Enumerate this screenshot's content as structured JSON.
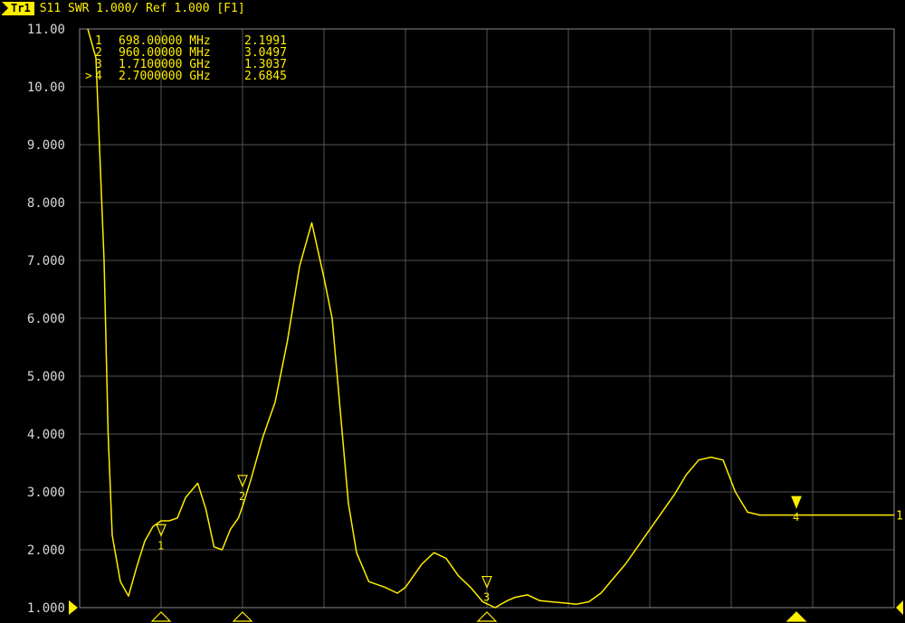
{
  "header": {
    "trace_label": "Tr1",
    "trace_info": "S11 SWR 1.000/ Ref 1.000 [F1]"
  },
  "colors": {
    "trace": "#ffee00",
    "grid": "#555555",
    "background": "#000000",
    "axis_text": "#d8d8d8"
  },
  "chart_data": {
    "type": "line",
    "title": "",
    "xlabel": "",
    "ylabel": "",
    "grid": true,
    "xlim": [
      0,
      10
    ],
    "ylim": [
      1,
      11
    ],
    "yticks": [
      "11.00",
      "10.00",
      "9.000",
      "8.000",
      "7.000",
      "6.000",
      "5.000",
      "4.000",
      "3.000",
      "2.000",
      "1.000"
    ],
    "series": [
      {
        "x": [
          0.1,
          0.2,
          0.3,
          0.35,
          0.4,
          0.5,
          0.6,
          0.7,
          0.8,
          0.9,
          1.0,
          1.1,
          1.2,
          1.3,
          1.45,
          1.55,
          1.65,
          1.75,
          1.85,
          1.95,
          2.0,
          2.1,
          2.25,
          2.4,
          2.55,
          2.7,
          2.85,
          3.0,
          3.1,
          3.2,
          3.3,
          3.4,
          3.55,
          3.75,
          3.9,
          4.0,
          4.2,
          4.35,
          4.5,
          4.65,
          4.8,
          4.95,
          5.1,
          5.25,
          5.35,
          5.5,
          5.65,
          5.8,
          5.95,
          6.1,
          6.25,
          6.4,
          6.55,
          6.7,
          6.85,
          7.0,
          7.15,
          7.3,
          7.45,
          7.6,
          7.75,
          7.9,
          8.05,
          8.2,
          8.35,
          8.5,
          8.65,
          8.8,
          8.95,
          9.1,
          9.25,
          9.4,
          9.55,
          9.7,
          9.85,
          10.0
        ],
        "y": [
          11.0,
          10.5,
          7.0,
          4.0,
          2.25,
          1.45,
          1.2,
          1.7,
          2.15,
          2.4,
          2.5,
          2.5,
          2.55,
          2.9,
          3.15,
          2.7,
          2.05,
          2.0,
          2.35,
          2.55,
          2.75,
          3.2,
          3.95,
          4.55,
          5.6,
          6.9,
          7.65,
          6.7,
          6.0,
          4.4,
          2.8,
          1.95,
          1.45,
          1.35,
          1.25,
          1.35,
          1.75,
          1.95,
          1.85,
          1.55,
          1.35,
          1.1,
          1.0,
          1.12,
          1.18,
          1.22,
          1.12,
          1.1,
          1.08,
          1.06,
          1.1,
          1.25,
          1.5,
          1.75,
          2.05,
          2.35,
          2.65,
          2.95,
          3.3,
          3.55,
          3.6,
          3.55,
          3.0,
          2.65,
          2.6,
          2.6,
          2.6,
          2.6,
          2.6,
          2.6,
          2.6,
          2.6,
          2.6,
          2.6,
          2.6,
          2.6
        ]
      }
    ],
    "markers": [
      {
        "id": "1",
        "freq": "698.00000 MHz",
        "value": "2.1991",
        "x": 1.0,
        "y": 2.1991,
        "active": false
      },
      {
        "id": "2",
        "freq": "960.00000 MHz",
        "value": "3.0497",
        "x": 2.0,
        "y": 3.0497,
        "active": false
      },
      {
        "id": "3",
        "freq": "1.7100000 GHz",
        "value": "1.3037",
        "x": 5.0,
        "y": 1.3037,
        "active": false
      },
      {
        "id": "4",
        "freq": "2.7000000 GHz",
        "value": "2.6845",
        "x": 8.8,
        "y": 2.6845,
        "active": true
      }
    ],
    "ref_label": "1",
    "ref_marker_glyph": ">"
  }
}
